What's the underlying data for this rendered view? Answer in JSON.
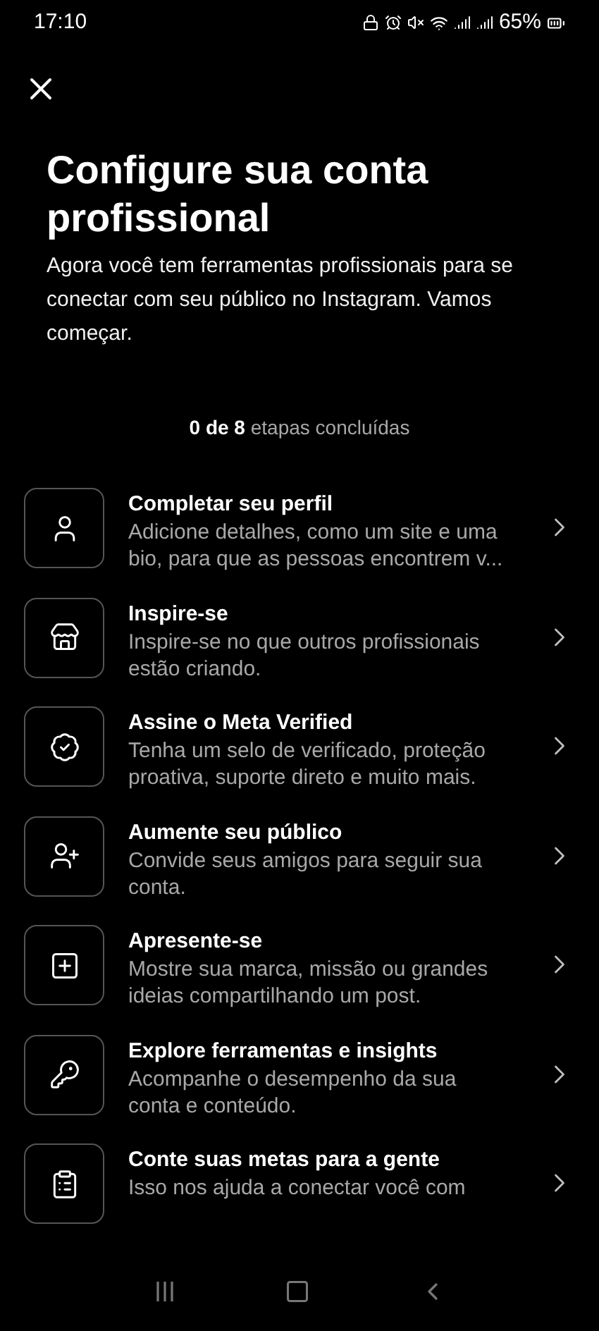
{
  "status_bar": {
    "time": "17:10",
    "battery": "65%"
  },
  "title": "Configure sua conta profissional",
  "subtitle": "Agora você tem ferramentas profissionais para se conectar com seu público no Instagram. Vamos começar.",
  "progress": "**0 de 8** etapas concluídas",
  "steps": [
    {
      "kind": "person",
      "title": "Completar seu perfil",
      "description": "Adicione detalhes, como um site e uma bio, para que as pessoas encontrem v..."
    },
    {
      "kind": "store",
      "title": "Inspire-se",
      "description": "Inspire-se no que outros profissionais estão criando."
    },
    {
      "kind": "badge",
      "title": "Assine o Meta Verified",
      "description": "Tenha um selo de verificado, proteção proativa, suporte direto e muito mais."
    },
    {
      "kind": "add-person",
      "title": "Aumente seu público",
      "description": "Convide seus amigos para seguir sua conta."
    },
    {
      "kind": "plus-square",
      "title": "Apresente-se",
      "description": "Mostre sua marca, missão ou grandes ideias compartilhando um post."
    },
    {
      "kind": "key",
      "title": "Explore ferramentas e insights",
      "description": "Acompanhe o desempenho da sua conta e conteúdo."
    },
    {
      "kind": "clipboard",
      "title": "Conte suas metas para a gente",
      "description": "Isso nos ajuda a conectar você com"
    }
  ]
}
